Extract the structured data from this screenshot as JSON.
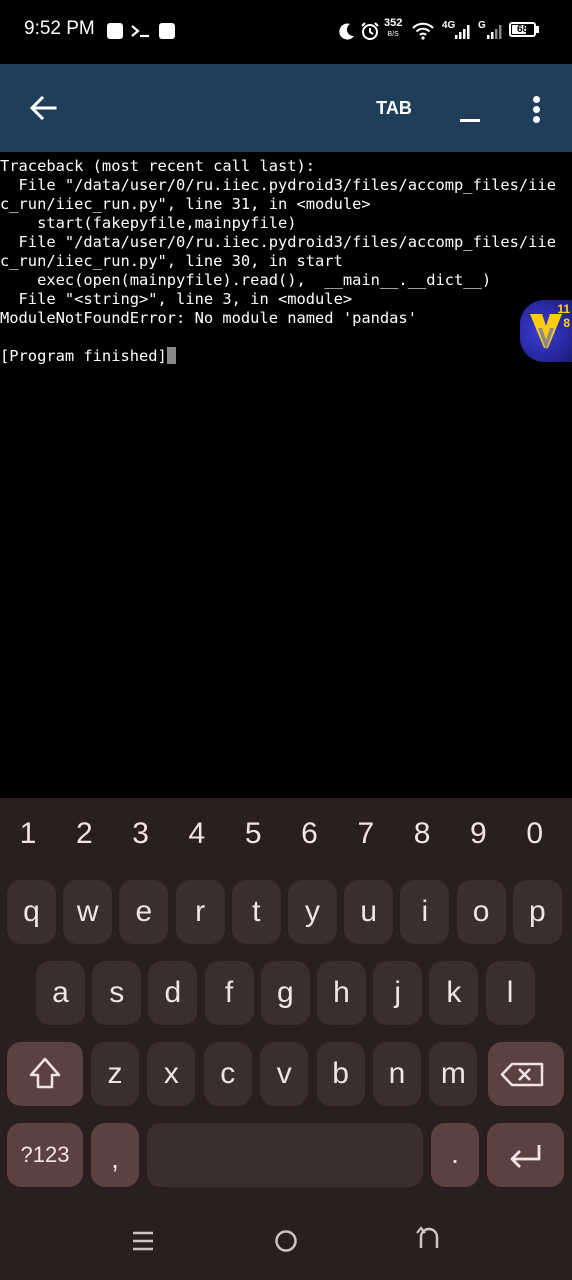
{
  "status_bar": {
    "time": "9:52 PM",
    "net_speed": "352",
    "net_speed_unit": "B/S",
    "network_4g": "4G",
    "network_g": "G",
    "battery": "68",
    "battery_level": 0.68,
    "icons": [
      "notification-square-icon",
      "terminal-icon",
      "notification-square-icon",
      "moon-icon",
      "alarm-icon",
      "wifi-icon",
      "signal-icon",
      "signal-icon",
      "battery-icon"
    ]
  },
  "toolbar": {
    "background": "#1e3e5a",
    "back_icon": "arrow-left-icon",
    "tab_label": "TAB",
    "underscore_icon": "underscore-icon",
    "more_icon": "more-vertical-icon"
  },
  "terminal": {
    "lines": [
      "Traceback (most recent call last):",
      "  File \"/data/user/0/ru.iiec.pydroid3/files/accomp_files/iie",
      "c_run/iiec_run.py\", line 31, in <module>",
      "    start(fakepyfile,mainpyfile)",
      "  File \"/data/user/0/ru.iiec.pydroid3/files/accomp_files/iie",
      "c_run/iiec_run.py\", line 30, in start",
      "    exec(open(mainpyfile).read(),  __main__.__dict__)",
      "  File \"<string>\", line 3, in <module>",
      "ModuleNotFoundError: No module named 'pandas'",
      "",
      "[Program finished]"
    ],
    "bubble_badge_top": "11",
    "bubble_badge_bottom": "8"
  },
  "keyboard": {
    "number_row": [
      "1",
      "2",
      "3",
      "4",
      "5",
      "6",
      "7",
      "8",
      "9",
      "0"
    ],
    "row1": [
      "q",
      "w",
      "e",
      "r",
      "t",
      "y",
      "u",
      "i",
      "o",
      "p"
    ],
    "row2": [
      "a",
      "s",
      "d",
      "f",
      "g",
      "h",
      "j",
      "k",
      "l"
    ],
    "row3": [
      "z",
      "x",
      "c",
      "v",
      "b",
      "n",
      "m"
    ],
    "shift_icon": "shift-icon",
    "backspace_icon": "backspace-icon",
    "symbols_label": "?123",
    "comma_label": ",",
    "period_label": ".",
    "enter_icon": "enter-icon",
    "key_color": "#3d2e2e",
    "special_key_color": "#5c4141",
    "background": "#2a1f1f"
  },
  "nav_bar": {
    "icons": [
      "recents-icon",
      "home-icon",
      "back-icon"
    ]
  }
}
